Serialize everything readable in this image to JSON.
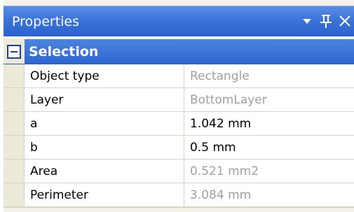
{
  "panel": {
    "title": "Properties",
    "controls": {
      "dropdown": "▼",
      "pin": "ᚹ",
      "close": "✕"
    }
  },
  "category": {
    "label": "Selection",
    "collapse_symbol": "−"
  },
  "rows": [
    {
      "name": "Object type",
      "value": "Rectangle",
      "editable": false
    },
    {
      "name": "Layer",
      "value": "BottomLayer",
      "editable": false
    },
    {
      "name": "a",
      "value": "1.042 mm",
      "editable": true
    },
    {
      "name": "b",
      "value": "0.5 mm",
      "editable": true
    },
    {
      "name": "Area",
      "value": "0.521 mm2",
      "editable": false
    },
    {
      "name": "Perimeter",
      "value": "3.084 mm",
      "editable": false
    }
  ]
}
